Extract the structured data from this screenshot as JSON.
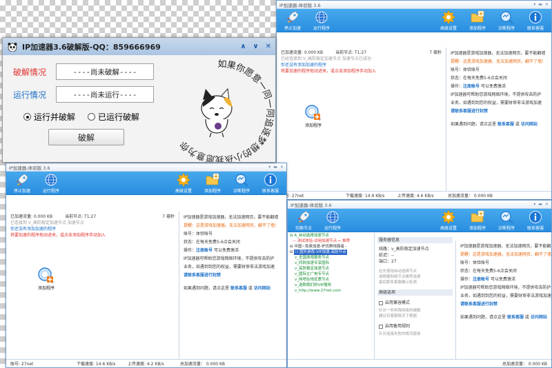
{
  "app_title": "IP加速器-体验版 3.6",
  "toolbar": {
    "stop": "停止加速",
    "run_program": "运行程序",
    "switch_node": "切换节点",
    "advanced": "高级设置",
    "add_program": "添加程序",
    "diagnose": "诊断程序",
    "contact": "联系客服"
  },
  "status": {
    "accel_label": "已加速流量:",
    "accel_value": "0.000 KB",
    "node_label": "当前节点:",
    "node_value": "T1:27",
    "timer": "7 毫秒",
    "line_connected": "已经连接到 V_高防稳定加速节点 加速节点已成功",
    "line_connecting": "已连接到 V_高防稳定加速节点 加速节点",
    "line_add": "你还没有添加加速的程序",
    "line_hint": "将要加速的程序拖动进来，或点击添加程序手动加入"
  },
  "add_program_label": "添加程序",
  "right": {
    "p1": "IP加速器是游戏加速器，无法加速网页，要不能翻墙",
    "p2": "提醒：这是游戏加速器，无法加速网页，翻不了墙!",
    "account_label": "账号：",
    "account_value": "体验账号",
    "state_label": "状态：",
    "state_value": "在每天免费5-6点会关闭",
    "op_label": "操作：",
    "op_link": "注册账号",
    "op_text": "可以免费激活",
    "p3": "IP加速器可帮助您游戏网络环境，不提供攻击防护",
    "p4": "业务，如遇到到您的权益，需要财审非法游戏加速",
    "p5_link": "请联系客服进行封禁",
    "p6_pre": "如果遇到问题，请点这里",
    "p6_link1": "联系客服",
    "p6_mid": "或",
    "p6_link2": "访问网站"
  },
  "bottom": {
    "users": "账号: 27net",
    "down_a": "下载速度: 14.9 KB/s",
    "up_a": "上传速度: 4.6 KB/s",
    "down_b": "下载速度: 14.6 KB/s",
    "up_b": "上传速度: 4.2 KB/s",
    "total": "总加速流量：  0.000 KB"
  },
  "crack": {
    "title": "IP加速器3.6破解版-QQ：859666969",
    "crack_status_label": "破解情况",
    "crack_status_value": "----尚未破解----",
    "run_status_label": "运行情况",
    "run_status_value": "----尚未运行----",
    "radio_run_and_crack": "运行并破解",
    "radio_already_running": "已运行破解",
    "crack_button": "破解",
    "art_text": "如果你愿意一同一同追逐梦想的小孩我愿意为你"
  },
  "tree": {
    "items": [
      "A_自动选择加速节点",
      "--- 测试体验-试用加速节点 ← 推荐",
      "中国~免费加速-护优群线路者 -",
      "☐ 国外游戏-VIP加速-高防节点",
      "v_全国游戏服务节点",
      "v_同网加速专享国际",
      "v_高防稳定加速节点",
      "v_国际主广电专节点",
      "v_网吧在线优惠节点",
      "v_选购我们的VIP服务",
      "v_http://www.27net.com"
    ]
  },
  "mid": {
    "server_info": "服务器信息",
    "node_label": "线路：",
    "node_value": "v_高防稳定加速节点",
    "delay_label": "延迟：",
    "delay_value": "--",
    "port_label": "端口：",
    "port_value": "27",
    "note1": "在先使用自动选择节点",
    "note2": "或根据网络节点推荐选择",
    "note3": "最后联系客服确认检测",
    "adv_option": "高级选项",
    "opt1": "启用兼容模式",
    "note4": "针对一些特殊网络的编解",
    "note5": "建议仅客服情况下根据",
    "opt2": "启用备用规则",
    "note6": "针对连接失败的情况使用"
  },
  "colors": {
    "toolbar_blue": "#2a8ee0",
    "link_blue": "#1a6fc8",
    "warn_orange": "#e86a10",
    "alert_red": "#e0322d"
  },
  "icons": {
    "stop": "rocket-icon",
    "run": "globe-icon",
    "advanced": "gear-icon",
    "add": "folder-plus-icon",
    "diagnose": "wrench-magnifier-icon",
    "contact": "info-icon"
  }
}
